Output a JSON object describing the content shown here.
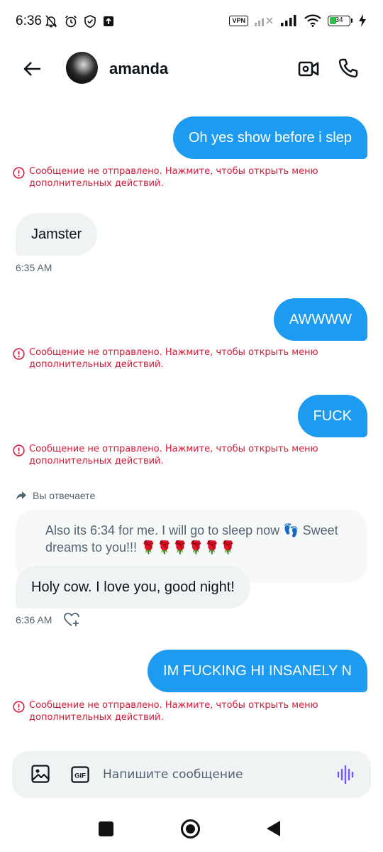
{
  "status_bar": {
    "time": "6:36",
    "vpn_label": "VPN",
    "battery": "34",
    "icons": [
      "mute-bell-icon",
      "alarm-icon",
      "shield-icon",
      "upload-icon",
      "signal-icon",
      "wifi-icon",
      "charging-icon"
    ]
  },
  "header": {
    "contact_name": "amanda",
    "icons": [
      "back-arrow-icon",
      "video-call-icon",
      "phone-icon"
    ]
  },
  "messages": {
    "m1": {
      "text": "Oh yes show before i slep",
      "error": "Сообщение не отправлено. Нажмите, чтобы открыть меню дополнительных действий."
    },
    "m2": {
      "text": "Jamster",
      "time": "6:35 AM"
    },
    "m3": {
      "text": "AWWWW",
      "error": "Сообщение не отправлено. Нажмите, чтобы открыть меню дополнительных действий."
    },
    "m4": {
      "text": "FUCK",
      "error": "Сообщение не отправлено. Нажмите, чтобы открыть меню дополнительных действий."
    },
    "reply": {
      "hint": "Вы отвечаете",
      "quoted": "Also its 6:34 for me. I will go to sleep now 👣 Sweet dreams to you!!! 🌹🌹🌹🌹🌹🌹",
      "text": "Holy cow. I love you, good night!",
      "time": "6:36 AM"
    },
    "m5": {
      "text": "IM FUCKING HI INSANELY N",
      "error": "Сообщение не отправлено. Нажмите, чтобы открыть меню дополнительных действий."
    }
  },
  "composer": {
    "placeholder": "Напишите сообщение",
    "gif_label": "GIF"
  },
  "colors": {
    "accent": "#1d9bf0",
    "error": "#d31a3a",
    "incoming_bubble": "#eff3f4",
    "voice_icon": "#7856ff"
  }
}
